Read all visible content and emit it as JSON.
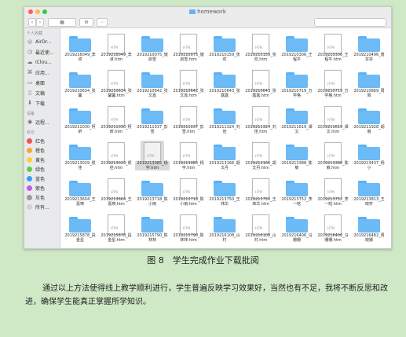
{
  "window": {
    "title": "homework"
  },
  "toolbar": {
    "view_label": "▦",
    "arrange_label": "⚙"
  },
  "sidebar": {
    "favorites_head": "个人收藏",
    "favorites": [
      {
        "label": "AirDr...",
        "icon": "airdrop-icon",
        "glyph": "◎"
      },
      {
        "label": "最近使...",
        "icon": "recents-icon",
        "glyph": "◷"
      },
      {
        "label": "iClou...",
        "icon": "icloud-icon",
        "glyph": "☁"
      },
      {
        "label": "应用...",
        "icon": "applications-icon",
        "glyph": "⌘"
      },
      {
        "label": "桌面",
        "icon": "desktop-icon",
        "glyph": "▭"
      },
      {
        "label": "文稿",
        "icon": "documents-icon",
        "glyph": "▯"
      },
      {
        "label": "下载",
        "icon": "downloads-icon",
        "glyph": "⬇"
      }
    ],
    "devices_head": "设备",
    "devices": [
      {
        "label": "远程...",
        "icon": "disc-icon",
        "glyph": "◉"
      }
    ],
    "tags_head": "标记",
    "tags": [
      {
        "label": "红色",
        "color": "#f25353"
      },
      {
        "label": "橙色",
        "color": "#f7a43b"
      },
      {
        "label": "黄色",
        "color": "#f5d431"
      },
      {
        "label": "绿色",
        "color": "#63cc46"
      },
      {
        "label": "蓝色",
        "color": "#3c9cf5"
      },
      {
        "label": "紫色",
        "color": "#be5fdc"
      },
      {
        "label": "灰色",
        "color": "#9a9a9a"
      },
      {
        "label": "所有...",
        "color": "#d0d0d0"
      }
    ]
  },
  "files": [
    {
      "name": "2019216049_李卓",
      "type": "folder"
    },
    {
      "name": "2019216049_李卓.htm",
      "type": "doc"
    },
    {
      "name": "2019210075_储启雪",
      "type": "folder"
    },
    {
      "name": "2019210075_储启雪.htm",
      "type": "doc"
    },
    {
      "name": "2019210159_张欢",
      "type": "folder"
    },
    {
      "name": "2019210159_张欢.htm",
      "type": "doc"
    },
    {
      "name": "2019210306_王程平",
      "type": "folder"
    },
    {
      "name": "2019210306_王程平.htm",
      "type": "doc"
    },
    {
      "name": "2019210496_唐芬芬",
      "type": "folder"
    },
    {
      "name": "2019210634_张馨",
      "type": "folder"
    },
    {
      "name": "2019210634_张馨馨.htm",
      "type": "doc"
    },
    {
      "name": "2019210642_张文嘉",
      "type": "folder"
    },
    {
      "name": "2019210642_张文嘉.htm",
      "type": "doc"
    },
    {
      "name": "2019210643_张露露",
      "type": "folder"
    },
    {
      "name": "2019210643_张露露.htm",
      "type": "doc"
    },
    {
      "name": "2019210719_万学格",
      "type": "folder"
    },
    {
      "name": "2019210719_万学格.htm",
      "type": "doc"
    },
    {
      "name": "2019210869_周佩",
      "type": "folder"
    },
    {
      "name": "2019211030_柯昕",
      "type": "folder"
    },
    {
      "name": "2019211030_柯昕.htm",
      "type": "doc"
    },
    {
      "name": "2019211037_彭雪",
      "type": "folder"
    },
    {
      "name": "2019211037_彭雪.htm",
      "type": "doc"
    },
    {
      "name": "2019211324_刘佳",
      "type": "folder"
    },
    {
      "name": "2019211324_刘佳.htm",
      "type": "doc"
    },
    {
      "name": "2019211619_谭文",
      "type": "folder"
    },
    {
      "name": "2019211619_谭文.htm",
      "type": "doc"
    },
    {
      "name": "2019211928_胡丽",
      "type": "folder"
    },
    {
      "name": "2019213029_侯佳",
      "type": "folder"
    },
    {
      "name": "2019213029_侯佳.htm",
      "type": "doc"
    },
    {
      "name": "2019213085_杨宇.htm",
      "type": "doc",
      "selected": true
    },
    {
      "name": "2019213085_杨宇.htm",
      "type": "doc"
    },
    {
      "name": "2019213166_胡文丹",
      "type": "folder"
    },
    {
      "name": "2019213166_胡文丹.htm",
      "type": "doc"
    },
    {
      "name": "2019213388_陈敏",
      "type": "folder"
    },
    {
      "name": "2019213388_陈敏.htm",
      "type": "doc"
    },
    {
      "name": "2019213437_杨小",
      "type": "folder"
    },
    {
      "name": "2019213604_王嘉瑛",
      "type": "folder"
    },
    {
      "name": "2019213604_王嘉瑛.htm",
      "type": "doc"
    },
    {
      "name": "2019213718_陈小雨",
      "type": "folder"
    },
    {
      "name": "2019213718_陈小雨.htm",
      "type": "doc"
    },
    {
      "name": "2019213750_王玮华",
      "type": "folder"
    },
    {
      "name": "2019213750_王玮华.htm",
      "type": "doc"
    },
    {
      "name": "2019213752_李一晗",
      "type": "folder"
    },
    {
      "name": "2019213752_李一晗.htm",
      "type": "doc"
    },
    {
      "name": "2019213813_王晓轩",
      "type": "folder"
    },
    {
      "name": "2019215878_段金星",
      "type": "folder"
    },
    {
      "name": "2019215878_段金星.htm",
      "type": "doc"
    },
    {
      "name": "2019215790_陈林林",
      "type": "folder"
    },
    {
      "name": "2019215790_陈林林.htm",
      "type": "doc"
    },
    {
      "name": "2019216108_山村",
      "type": "folder"
    },
    {
      "name": "2019216108_山村.htm",
      "type": "doc"
    },
    {
      "name": "2019216406_马珊珊",
      "type": "folder"
    },
    {
      "name": "2019216406_马珊珊.htm",
      "type": "doc"
    },
    {
      "name": "2019216482_周晓娜",
      "type": "folder"
    }
  ],
  "doc_badge": "HTM",
  "caption": "图 8　学生完成作业下载批阅",
  "paragraph": "通过以上方法使得线上教学顺利进行，学生普遍反映学习效果好，当然也有不足，我将不断反思和改进，确保学生能真正掌握所学知识。"
}
